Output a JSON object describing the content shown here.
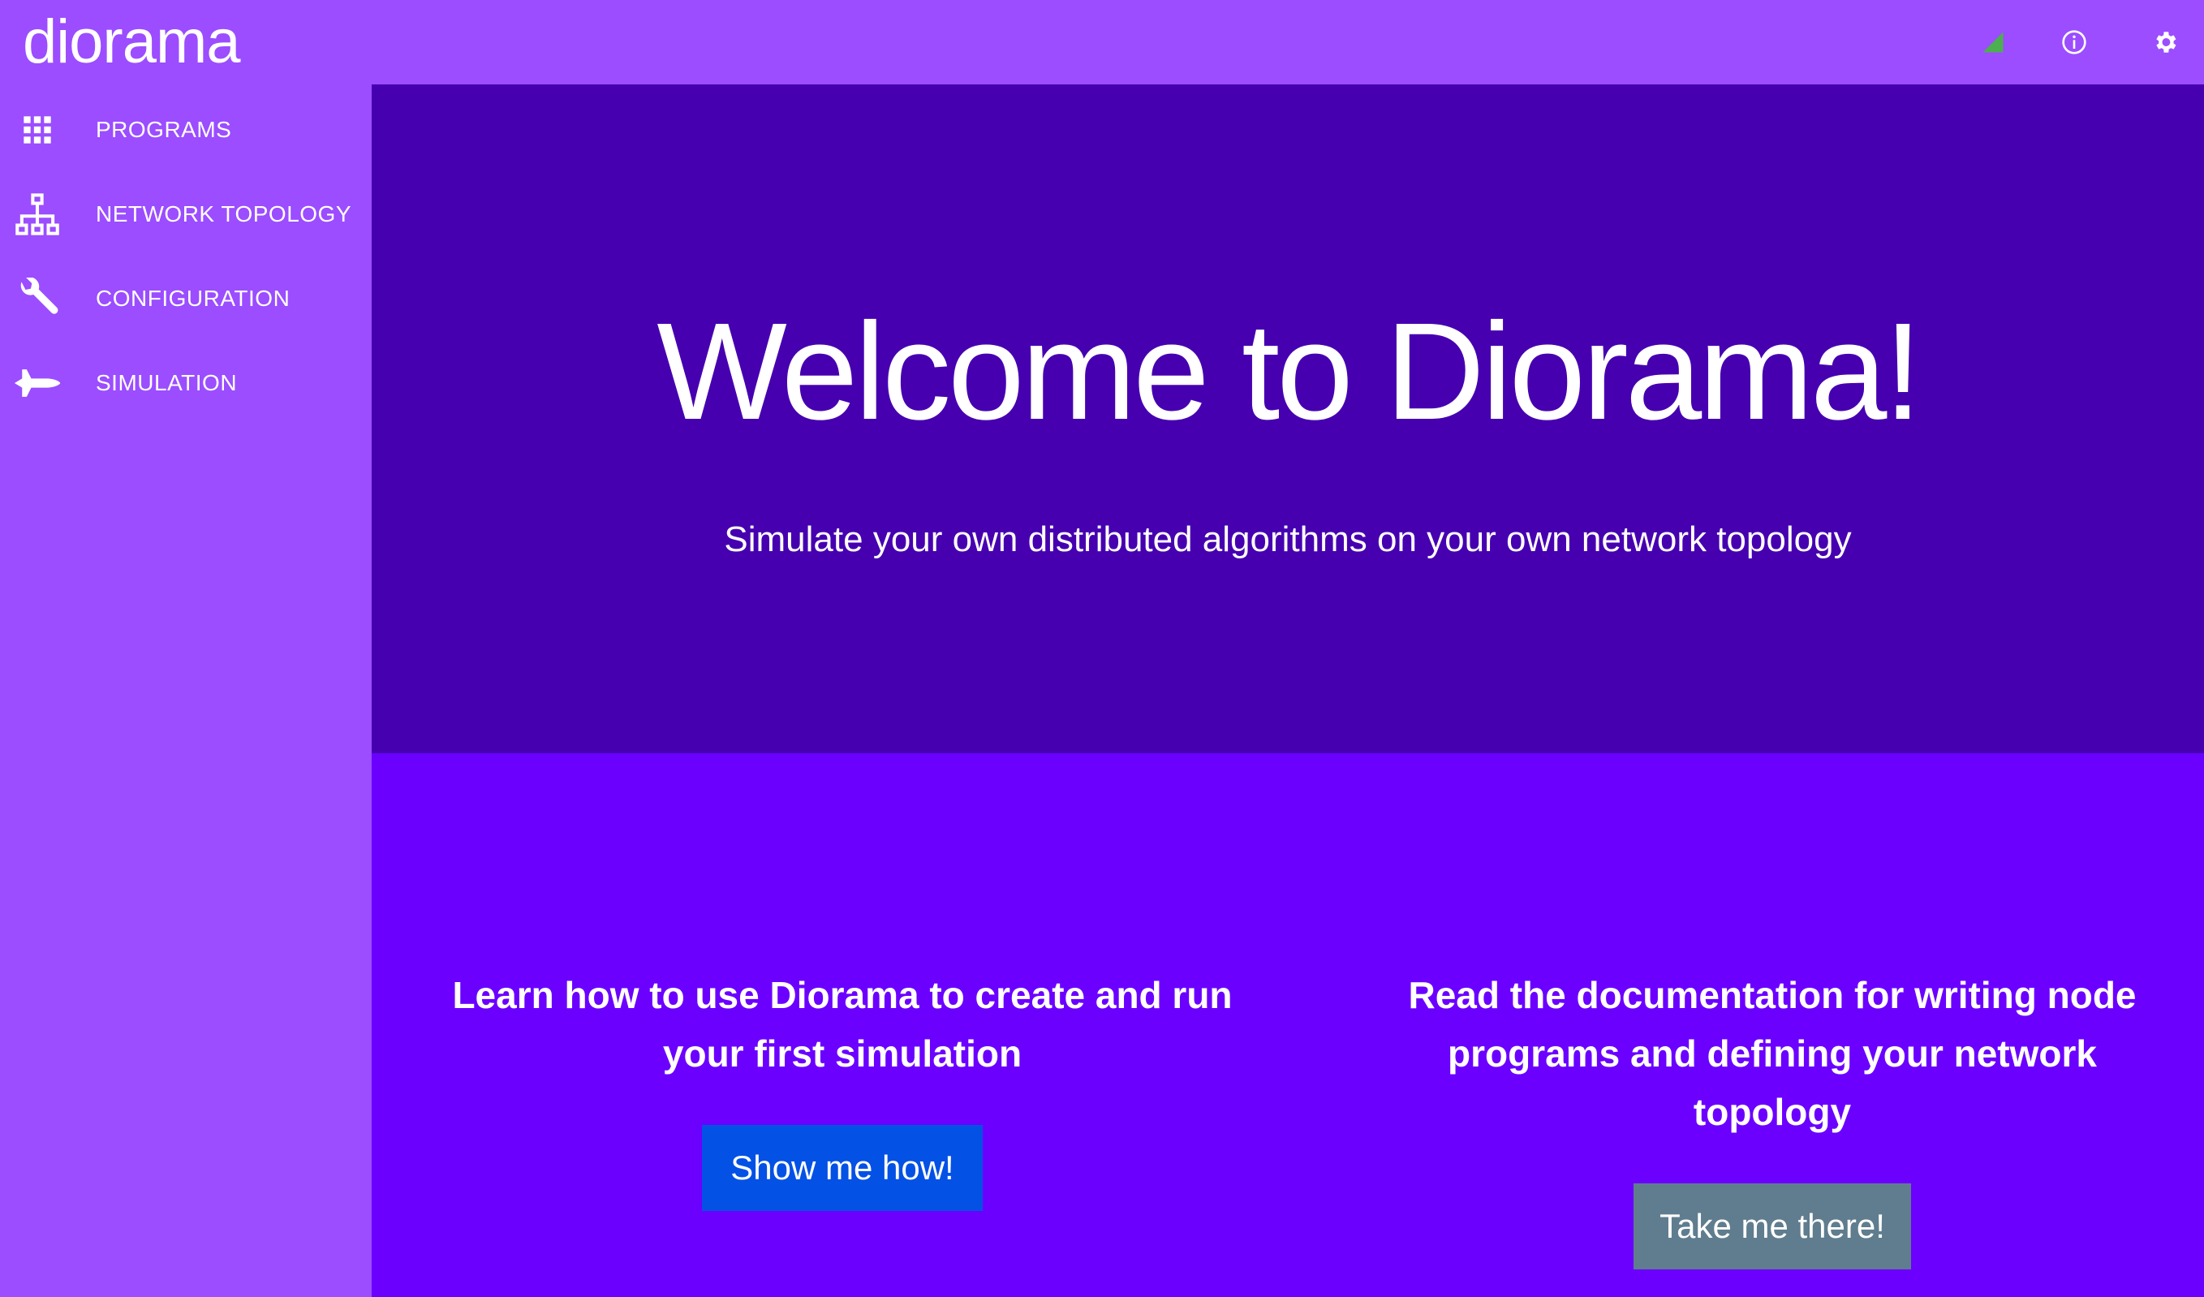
{
  "app": {
    "brand": "diorama"
  },
  "topbar": {
    "icons": [
      "signal-icon",
      "info-icon",
      "gear-icon"
    ],
    "colors": {
      "signal": "#4caf50"
    }
  },
  "sidebar": {
    "items": [
      {
        "label": "PROGRAMS",
        "icon": "grid-icon"
      },
      {
        "label": "NETWORK TOPOLOGY",
        "icon": "sitemap-icon"
      },
      {
        "label": "CONFIGURATION",
        "icon": "wrench-icon"
      },
      {
        "label": "SIMULATION",
        "icon": "shuttle-icon"
      }
    ]
  },
  "hero": {
    "title": "Welcome to Diorama!",
    "subtitle": "Simulate your own distributed algorithms on your own network topology"
  },
  "cards": {
    "tutorial": {
      "text": "Learn how to use Diorama to create and run your first simulation",
      "button": "Show me how!"
    },
    "docs": {
      "text": "Read the documentation for writing node programs and defining your network topology",
      "button": "Take me there!"
    }
  },
  "colors": {
    "sidebar": "#9b4dff",
    "hero": "#4600b0",
    "lower": "#6b00ff",
    "primary_button": "#0451e5",
    "secondary_button": "#5f7d8e"
  }
}
